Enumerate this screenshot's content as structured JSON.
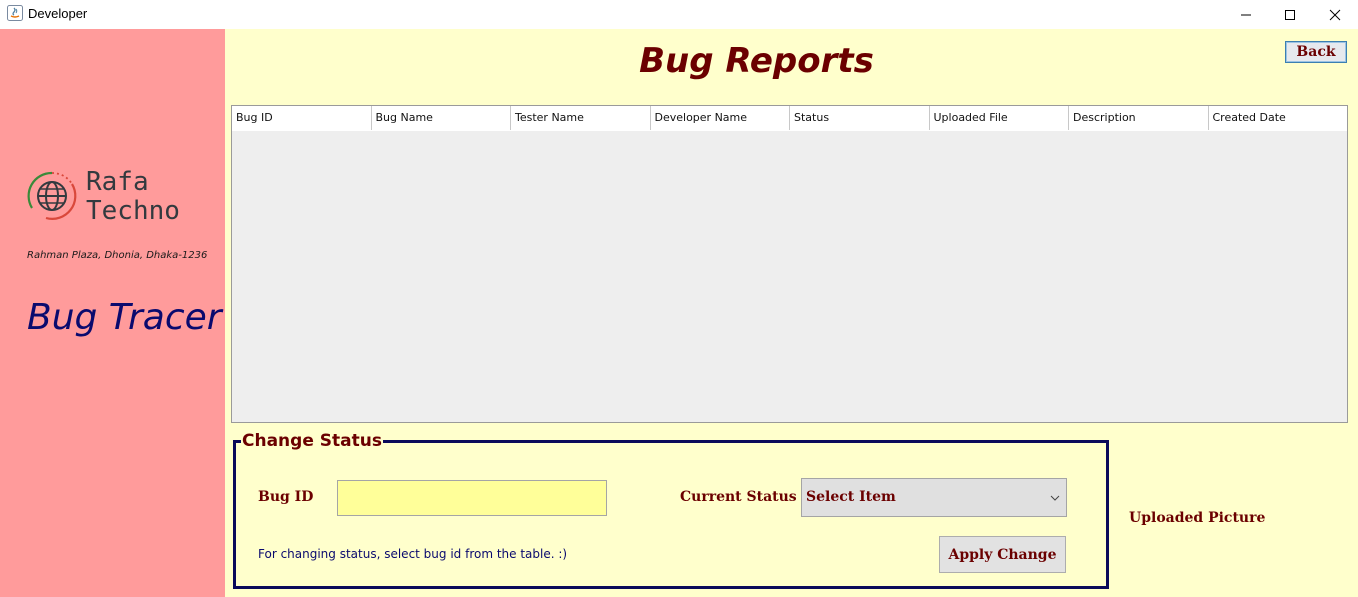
{
  "window": {
    "title": "Developer",
    "icon": "java-icon",
    "controls": [
      "minimize-icon",
      "maximize-icon",
      "close-icon"
    ]
  },
  "sidebar": {
    "brand_line1": "Rafa",
    "brand_line2": "Techno",
    "address": "Rahman Plaza, Dhonia, Dhaka-1236",
    "app_name": "Bug Tracer",
    "background": "#ff9b9b"
  },
  "main": {
    "title": "Bug Reports",
    "back_label": "Back",
    "background": "#ffffcc",
    "table": {
      "columns": [
        "Bug ID",
        "Bug Name",
        "Tester Name",
        "Developer Name",
        "Status",
        "Uploaded File",
        "Description",
        "Created Date"
      ],
      "rows": []
    },
    "change_status": {
      "legend": "Change Status",
      "bug_id_label": "Bug ID",
      "bug_id_value": "",
      "current_status_label": "Current Status",
      "status_selected": "Select Item",
      "hint": "For changing status, select bug id from the table. :)",
      "apply_label": "Apply Change"
    },
    "uploaded_picture_label": "Uploaded Picture"
  },
  "colors": {
    "accent_text": "#6b0000",
    "navy": "#0a0a6e",
    "input_yellow": "#ffff99"
  }
}
